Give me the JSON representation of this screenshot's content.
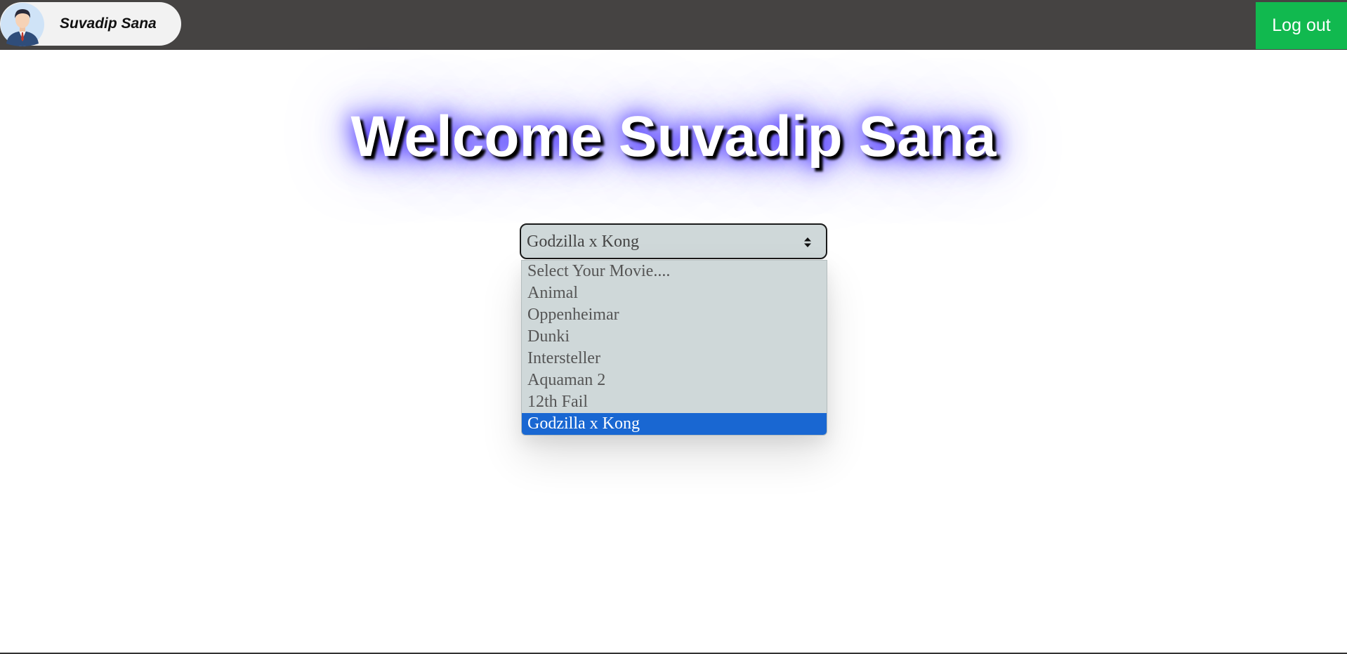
{
  "header": {
    "user_name": "Suvadip Sana",
    "avatar_icon": "user-avatar-icon",
    "logout_label": "Log out",
    "bar_color": "#454342",
    "logout_color": "#11b94f"
  },
  "main": {
    "welcome_text": "Welcome Suvadip Sana",
    "movie_select": {
      "selected_value": "Godzilla x Kong",
      "options": [
        "Select Your Movie....",
        "Animal",
        "Oppenheimar",
        "Dunki",
        "Intersteller",
        "Aquaman 2",
        "12th Fail",
        "Godzilla x Kong"
      ],
      "selected_index": 7,
      "highlight_color": "#1967d2"
    }
  }
}
